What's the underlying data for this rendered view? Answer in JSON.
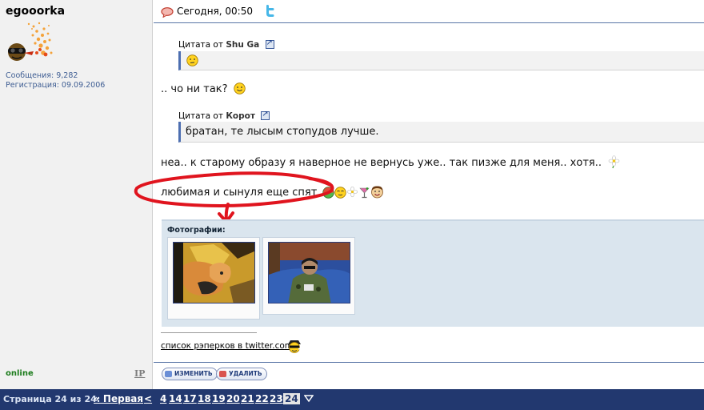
{
  "user": {
    "name": "egooorka",
    "posts_label": "Сообщения: 9,282",
    "reg_label": "Регистрация: 09.09.2006",
    "status": "online",
    "ip_link": "IP"
  },
  "post": {
    "date": "Сегодня, 00:50",
    "quote1": {
      "prefix": "Цитата от",
      "author": "Shu Ga"
    },
    "line1": ".. чо ни так?",
    "quote2": {
      "prefix": "Цитата от",
      "author": "Корот",
      "text": "братан, те лысым стопудов лучше."
    },
    "line2": "неа.. к старому образу я наверное не вернусь уже.. так пизже для меня.. хотя..",
    "line3": "любимая и сынуля еще спят",
    "photos_title": "Фотографии:",
    "signature_link": "список рэперков в twitter.com"
  },
  "buttons": {
    "edit": "ИЗМЕНИТЬ",
    "delete": "УДАЛИТЬ"
  },
  "pager": {
    "label": "Страница 24 из 24:",
    "first": "« Первая",
    "prev": "<",
    "pages": [
      "4",
      "14",
      "17",
      "18",
      "19",
      "20",
      "21",
      "22",
      "23"
    ],
    "current": "24"
  },
  "colors": {
    "pager_bg": "#22386f",
    "online": "#1c7c1c",
    "quote_border": "#4d6fb1",
    "photos_bg": "#dae5ee",
    "annotation": "#e0141e"
  },
  "icons": [
    "speech-bubble-icon",
    "twitter-icon",
    "smiley-icon",
    "flower-icon",
    "cocktail-icon",
    "pager-menu-icon"
  ]
}
